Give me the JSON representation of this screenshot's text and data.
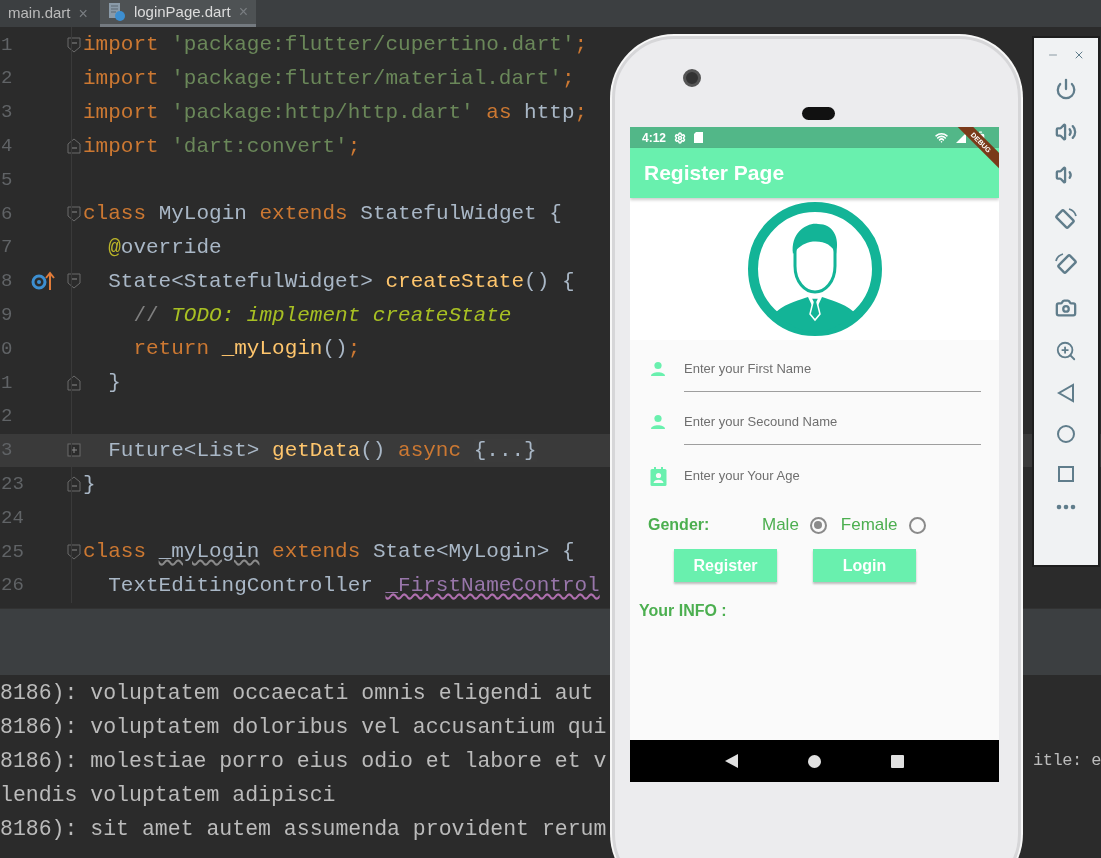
{
  "editor": {
    "tabs": [
      {
        "label": "main.dart",
        "selected": false,
        "close": "×"
      },
      {
        "label": "loginPage.dart",
        "selected": true,
        "close": "×"
      }
    ],
    "lines": [
      {
        "number": "1",
        "kind": "fold_start",
        "tokens": [
          {
            "text": "import ",
            "kind": "keyword"
          },
          {
            "text": "'package:flutter/cupertino.dart'",
            "kind": "string"
          },
          {
            "text": ";",
            "kind": "keyword"
          }
        ]
      },
      {
        "number": "2",
        "kind": "plain",
        "tokens": [
          {
            "text": "import ",
            "kind": "keyword"
          },
          {
            "text": "'package:flutter/material.dart'",
            "kind": "string"
          },
          {
            "text": ";",
            "kind": "keyword"
          }
        ]
      },
      {
        "number": "3",
        "kind": "plain",
        "tokens": [
          {
            "text": "import ",
            "kind": "keyword"
          },
          {
            "text": "'package:http/http.dart'",
            "kind": "string"
          },
          {
            "text": " as ",
            "kind": "keyword"
          },
          {
            "text": "http",
            "kind": "plain"
          },
          {
            "text": ";",
            "kind": "keyword"
          }
        ]
      },
      {
        "number": "4",
        "kind": "fold_end",
        "tokens": [
          {
            "text": "import ",
            "kind": "keyword"
          },
          {
            "text": "'dart:convert'",
            "kind": "string"
          },
          {
            "text": ";",
            "kind": "keyword"
          }
        ]
      },
      {
        "number": "5",
        "kind": "plain"
      },
      {
        "number": "6",
        "kind": "fold_start",
        "tokens": [
          {
            "text": "class ",
            "kind": "keyword"
          },
          {
            "text": "MyLogin ",
            "kind": "plain"
          },
          {
            "text": "extends ",
            "kind": "keyword"
          },
          {
            "text": "StatefulWidget {",
            "kind": "plain"
          }
        ]
      },
      {
        "number": "7",
        "kind": "plain",
        "tokens": [
          {
            "text": "  @",
            "kind": "annotation"
          },
          {
            "text": "override",
            "kind": "plain"
          }
        ]
      },
      {
        "number": "8",
        "kind": "fold_start",
        "override": true,
        "tokens": [
          {
            "text": "  State<StatefulWidget> ",
            "kind": "plain"
          },
          {
            "text": "createState",
            "kind": "function"
          },
          {
            "text": "() {",
            "kind": "plain"
          }
        ]
      },
      {
        "number": "9",
        "kind": "plain",
        "tokens": [
          {
            "text": "    // ",
            "kind": "comment"
          },
          {
            "text": "TODO: implement createState",
            "kind": "todo"
          }
        ]
      },
      {
        "number": "0",
        "kind": "plain",
        "tokens": [
          {
            "text": "    return ",
            "kind": "keyword"
          },
          {
            "text": "_myLogin",
            "kind": "function"
          },
          {
            "text": "()",
            "kind": "plain"
          },
          {
            "text": ";",
            "kind": "keyword"
          }
        ]
      },
      {
        "number": "1",
        "kind": "fold_end",
        "tokens": [
          {
            "text": "  }",
            "kind": "plain"
          }
        ]
      },
      {
        "number": "2",
        "kind": "plain"
      },
      {
        "number": "3",
        "kind": "folded",
        "current": true,
        "tokens": [
          {
            "text": "  Future<List> ",
            "kind": "plain"
          },
          {
            "text": "getData",
            "kind": "function"
          },
          {
            "text": "() ",
            "kind": "plain"
          },
          {
            "text": "async ",
            "kind": "keyword"
          },
          {
            "text": "{...}",
            "kind": "folded"
          }
        ]
      },
      {
        "number": "23",
        "kind": "fold_end",
        "tokens": [
          {
            "text": "}",
            "kind": "plain"
          }
        ]
      },
      {
        "number": "24",
        "kind": "plain"
      },
      {
        "number": "25",
        "kind": "fold_start",
        "tokens": [
          {
            "text": "class ",
            "kind": "keyword"
          },
          {
            "text": "_myLogin",
            "kind": "warning"
          },
          {
            "text": " extends ",
            "kind": "keyword"
          },
          {
            "text": "State<MyLogin> {",
            "kind": "plain"
          }
        ]
      },
      {
        "number": "26",
        "kind": "plain",
        "tokens": [
          {
            "text": "  TextEditingController ",
            "kind": "plain"
          },
          {
            "text": "_FirstNameControl",
            "kind": "field_warning"
          }
        ]
      }
    ]
  },
  "console": {
    "lines": [
      {
        "text": "8186): voluptatem occaecati omnis eligendi aut"
      },
      {
        "text": "8186): voluptatem doloribus vel accusantium qui"
      },
      {
        "text": "8186): molestiae porro eius odio et labore et v",
        "tail": "itle: e"
      },
      {
        "text": "lendis voluptatem adipisci"
      },
      {
        "text": "8186): sit amet autem assumenda provident rerum"
      }
    ]
  },
  "emulator": {
    "status_bar": {
      "time": "4:12"
    },
    "debug_banner": "DEBUG",
    "app_bar": {
      "title": "Register Page"
    },
    "fields": [
      {
        "placeholder": "Enter your First Name",
        "kind": "person",
        "underline": true
      },
      {
        "placeholder": "Enter your Secound Name",
        "kind": "person",
        "underline": true
      },
      {
        "placeholder": "Enter your Your Age",
        "kind": "badge",
        "underline": false
      }
    ],
    "gender": {
      "label": "Gender:",
      "options": [
        {
          "label": "Male",
          "selected": true
        },
        {
          "label": "Female",
          "selected": false
        }
      ]
    },
    "buttons": [
      "Register",
      "Login"
    ],
    "info_label": "Your INFO :"
  }
}
